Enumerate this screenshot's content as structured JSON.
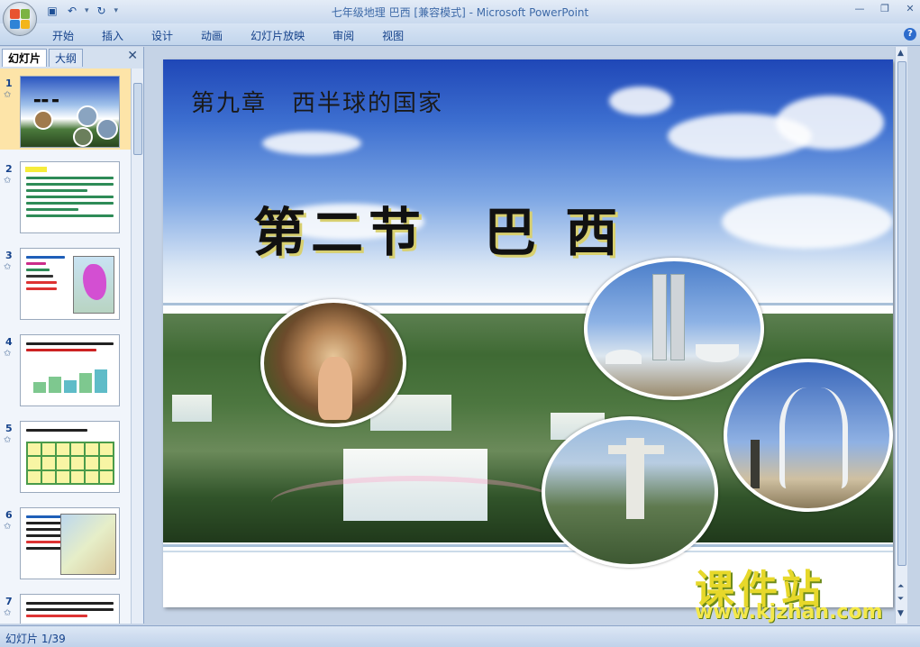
{
  "window": {
    "title": "七年级地理 巴西 [兼容模式] - Microsoft PowerPoint"
  },
  "quick_access": {
    "save_icon": "save-icon",
    "undo_icon": "undo-icon",
    "redo_icon": "redo-icon"
  },
  "ribbon": {
    "tabs": [
      {
        "label": "开始"
      },
      {
        "label": "插入"
      },
      {
        "label": "设计"
      },
      {
        "label": "动画"
      },
      {
        "label": "幻灯片放映"
      },
      {
        "label": "审阅"
      },
      {
        "label": "视图"
      }
    ]
  },
  "left_panel": {
    "tab_slides": "幻灯片",
    "tab_outline": "大纲",
    "thumbnails": [
      {
        "number": "1",
        "selected": true
      },
      {
        "number": "2"
      },
      {
        "number": "3"
      },
      {
        "number": "4"
      },
      {
        "number": "5"
      },
      {
        "number": "6"
      },
      {
        "number": "7"
      }
    ]
  },
  "slide": {
    "chapter_title": "第九章　西半球的国家",
    "section_title": "第二节　巴 西"
  },
  "watermark": {
    "brand": "课件站",
    "url": "www.kjzhan.com"
  },
  "status": {
    "slide_counter": "幻灯片 1/39"
  },
  "colors": {
    "accent": "#15428b",
    "watermark_yellow": "#e7d82a",
    "selected_thumb": "#fde4a8"
  }
}
